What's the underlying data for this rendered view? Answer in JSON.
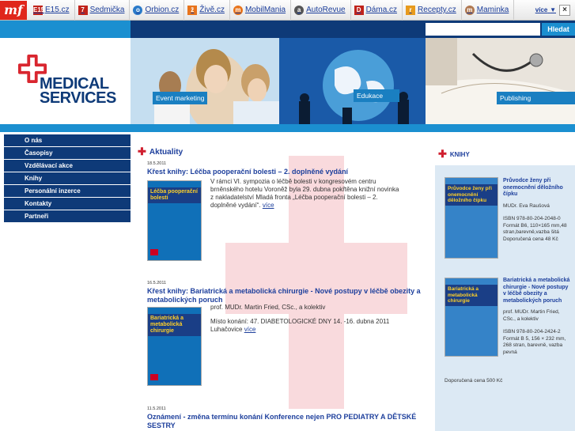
{
  "topbar": {
    "logo": "mf",
    "items": [
      {
        "icon": "E15",
        "label": "E15.cz",
        "color": "#c0231b"
      },
      {
        "icon": "7",
        "label": "Sedmička",
        "color": "#c0231b"
      },
      {
        "icon": "o",
        "label": "Orbion.cz",
        "color": "#2a7ac9"
      },
      {
        "icon": "ž",
        "label": "Živě.cz",
        "color": "#e8741c"
      },
      {
        "icon": "m",
        "label": "MobilMania",
        "color": "#e8741c"
      },
      {
        "icon": "a",
        "label": "AutoRevue",
        "color": "#555555"
      },
      {
        "icon": "D",
        "label": "Dáma.cz",
        "color": "#c0231b"
      },
      {
        "icon": "r",
        "label": "Recepty.cz",
        "color": "#e89a1c"
      },
      {
        "icon": "m",
        "label": "Maminka",
        "color": "#b07850"
      }
    ],
    "more": "více",
    "more_arrow": "▼",
    "close": "×"
  },
  "search": {
    "placeholder": "",
    "button": "Hledat"
  },
  "logo": {
    "line1": "MEDICAL",
    "line2": "SERVICES"
  },
  "banners": [
    "Event marketing",
    "Edukace",
    "Publishing"
  ],
  "nav": [
    "O nás",
    "Časopisy",
    "Vzdělávací akce",
    "Knihy",
    "Personální inzerce",
    "Kontakty",
    "Partneři"
  ],
  "main": {
    "section": "Aktuality",
    "articles": [
      {
        "date": "18.5.2011",
        "title": "Křest knihy: Léčba pooperační bolesti – 2. doplněné vydání",
        "text": "V rámci VI. sympozia o léčbě bolesti v kongresovém centru brněnského hotelu Voroněž byla 29. dubna pokřtěna knižní novinka z nakladatelství Mladá fronta „Léčba pooperační bolesti – 2. doplněné vydání“.",
        "more": "více",
        "cover_title": "Léčba pooperační bolesti"
      },
      {
        "date": "16.5.2011",
        "title": "Křest knihy: Bariatrická a metabolická chirurgie - Nové postupy v léčbě obezity a metabolických poruch",
        "text": "prof. MUDr. Martin Fried, CSc., a kolektiv",
        "text2": "Místo konání: 47. DIABETOLOGICKÉ DNY 14. -16. dubna 2011 Luhačovice",
        "more": "více",
        "cover_title": "Bariatrická a metabolická chirurgie"
      },
      {
        "date": "11.5.2011",
        "title": "Oznámení - změna termínu konání Konference nejen PRO PEDIATRY A DĚTSKÉ SESTRY"
      }
    ]
  },
  "right": {
    "section": "KNIHY",
    "books": [
      {
        "title": "Průvodce ženy při onemocnění děložního čípku",
        "author": "MUDr. Eva Raušová",
        "details": "ISBN 978-80-204-2048-0 Formát B6, 110×165 mm,48 stran,barevně,vazba šitá",
        "price": "Doporučená cena 48 Kč",
        "cover_title": "Průvodce ženy při onemocnění děložního čípku"
      },
      {
        "title": "Bariatrická a metabolická chirurgie - Nové postupy v léčbě obezity a metabolických poruch",
        "author": "prof. MUDr. Martin Fried, CSc., a kolektiv",
        "details": "ISBN 978-80-204-2424-2 Formát B 5, 156 × 232 mm, 268 stran, barevně, vazba pevná",
        "price": "Doporučená cena 500 Kč",
        "cover_title": "Bariatrická a metabolická chirurgie"
      }
    ]
  }
}
